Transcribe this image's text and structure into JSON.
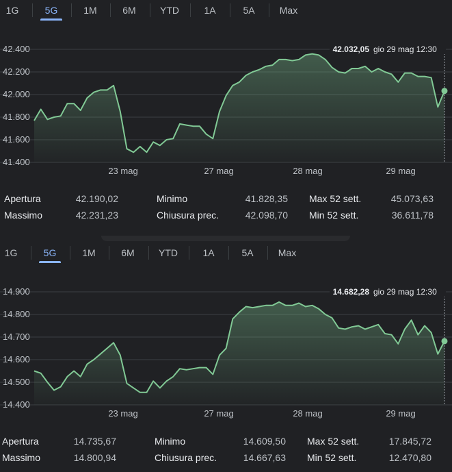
{
  "tabs": [
    "1G",
    "5G",
    "1M",
    "6M",
    "YTD",
    "1A",
    "5A",
    "Max"
  ],
  "active_tab": "5G",
  "colors": {
    "line": "#81c995",
    "accent": "#8ab4f8",
    "grid": "#3c4043",
    "background": "#202124"
  },
  "panels": [
    {
      "tooltip": {
        "value": "42.032,05",
        "date": "gio 29 mag 12:30"
      },
      "stats": [
        {
          "label": "Apertura",
          "value": "42.190,02"
        },
        {
          "label": "Massimo",
          "value": "42.231,23"
        },
        {
          "label": "Minimo",
          "value": "41.828,35"
        },
        {
          "label": "Chiusura prec.",
          "value": "42.098,70"
        },
        {
          "label": "Max 52 sett.",
          "value": "45.073,63"
        },
        {
          "label": "Min 52 sett.",
          "value": "36.611,78"
        }
      ]
    },
    {
      "tooltip": {
        "value": "14.682,28",
        "date": "gio 29 mag 12:30"
      },
      "stats": [
        {
          "label": "Apertura",
          "value": "14.735,67"
        },
        {
          "label": "Massimo",
          "value": "14.800,94"
        },
        {
          "label": "Minimo",
          "value": "14.609,50"
        },
        {
          "label": "Chiusura prec.",
          "value": "14.667,63"
        },
        {
          "label": "Max 52 sett.",
          "value": "17.845,72"
        },
        {
          "label": "Min 52 sett.",
          "value": "12.470,80"
        }
      ]
    }
  ],
  "chart_data": [
    {
      "type": "area",
      "ylim": [
        41400,
        42400
      ],
      "yticks": [
        42400,
        42200,
        42000,
        41800,
        41600,
        41400
      ],
      "ytick_labels": [
        "42.400",
        "42.200",
        "42.000",
        "41.800",
        "41.600",
        "41.400"
      ],
      "xticks": [
        "23 mag",
        "27 mag",
        "28 mag",
        "29 mag"
      ],
      "grid": true,
      "series": [
        {
          "y": [
            41770,
            41870,
            41780,
            41800,
            41810,
            41920,
            41920,
            41860,
            41970,
            42020,
            42040,
            42040,
            42080,
            41850,
            41520,
            41490,
            41540,
            41490,
            41580,
            41550,
            41600,
            41610,
            41740,
            41730,
            41720,
            41720,
            41650,
            41610,
            41850,
            41990,
            42080,
            42110,
            42170,
            42200,
            42220,
            42250,
            42260,
            42310,
            42310,
            42300,
            42310,
            42350,
            42360,
            42350,
            42310,
            42240,
            42200,
            42190,
            42230,
            42230,
            42250,
            42200,
            42230,
            42200,
            42180,
            42110,
            42190,
            42190,
            42160,
            42160,
            42150,
            41890,
            42032
          ]
        }
      ]
    },
    {
      "type": "area",
      "ylim": [
        14400,
        14900
      ],
      "yticks": [
        14900,
        14800,
        14700,
        14600,
        14500,
        14400
      ],
      "ytick_labels": [
        "14.900",
        "14.800",
        "14.700",
        "14.600",
        "14.500",
        "14.400"
      ],
      "xticks": [
        "23 mag",
        "27 mag",
        "28 mag",
        "29 mag"
      ],
      "grid": true,
      "series": [
        {
          "y": [
            14550,
            14540,
            14500,
            14465,
            14480,
            14525,
            14550,
            14525,
            14580,
            14600,
            14625,
            14650,
            14675,
            14620,
            14495,
            14475,
            14455,
            14455,
            14505,
            14475,
            14505,
            14525,
            14560,
            14555,
            14560,
            14565,
            14565,
            14535,
            14620,
            14650,
            14780,
            14810,
            14835,
            14830,
            14835,
            14840,
            14840,
            14855,
            14840,
            14840,
            14850,
            14835,
            14840,
            14825,
            14800,
            14785,
            14740,
            14735,
            14745,
            14750,
            14735,
            14745,
            14755,
            14715,
            14710,
            14670,
            14735,
            14775,
            14710,
            14750,
            14720,
            14625,
            14682
          ]
        }
      ]
    }
  ]
}
